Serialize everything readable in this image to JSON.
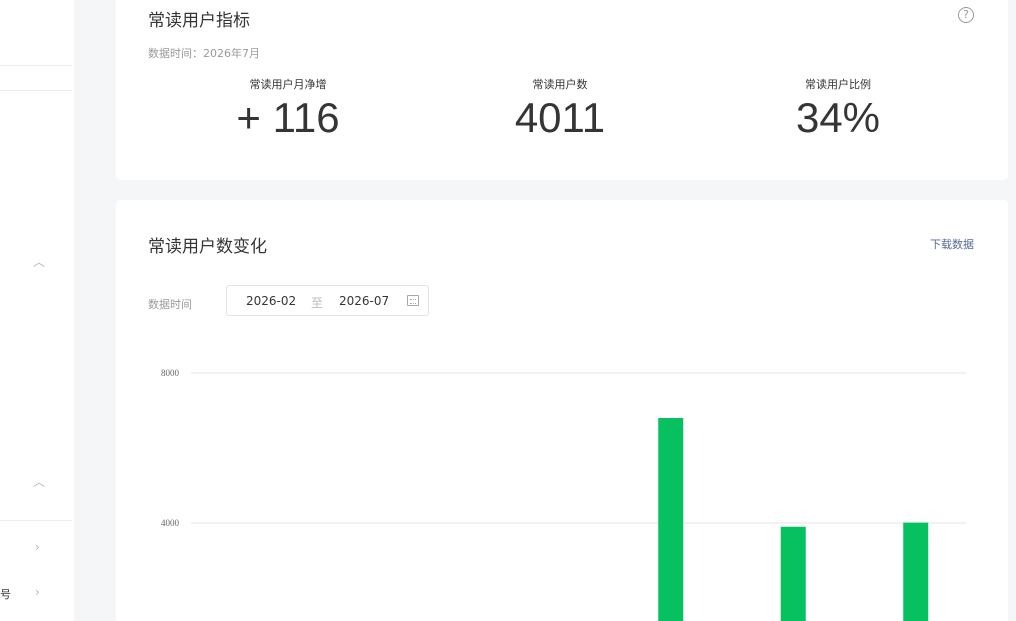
{
  "sidebar": {
    "partial_label": "号"
  },
  "metrics_card": {
    "title": "常读用户指标",
    "data_time": "数据时间：2026年7月",
    "items": [
      {
        "label": "常读用户月净增",
        "value": "+ 116"
      },
      {
        "label": "常读用户数",
        "value": "4011"
      },
      {
        "label": "常读用户比例",
        "value": "34%"
      }
    ]
  },
  "chart_card": {
    "title": "常读用户数变化",
    "download_label": "下载数据",
    "filter_label": "数据时间",
    "date_start": "2026-02",
    "date_separator": "至",
    "date_end": "2026-07"
  },
  "colors": {
    "bar": "#07c160",
    "link": "#576b95",
    "grid": "#e5e5e5"
  },
  "chart_data": {
    "type": "bar",
    "yticks": [
      4000,
      8000
    ],
    "ylim": [
      0,
      8000
    ],
    "grid": true,
    "values": [
      null,
      null,
      null,
      6800,
      3900,
      4011
    ]
  }
}
